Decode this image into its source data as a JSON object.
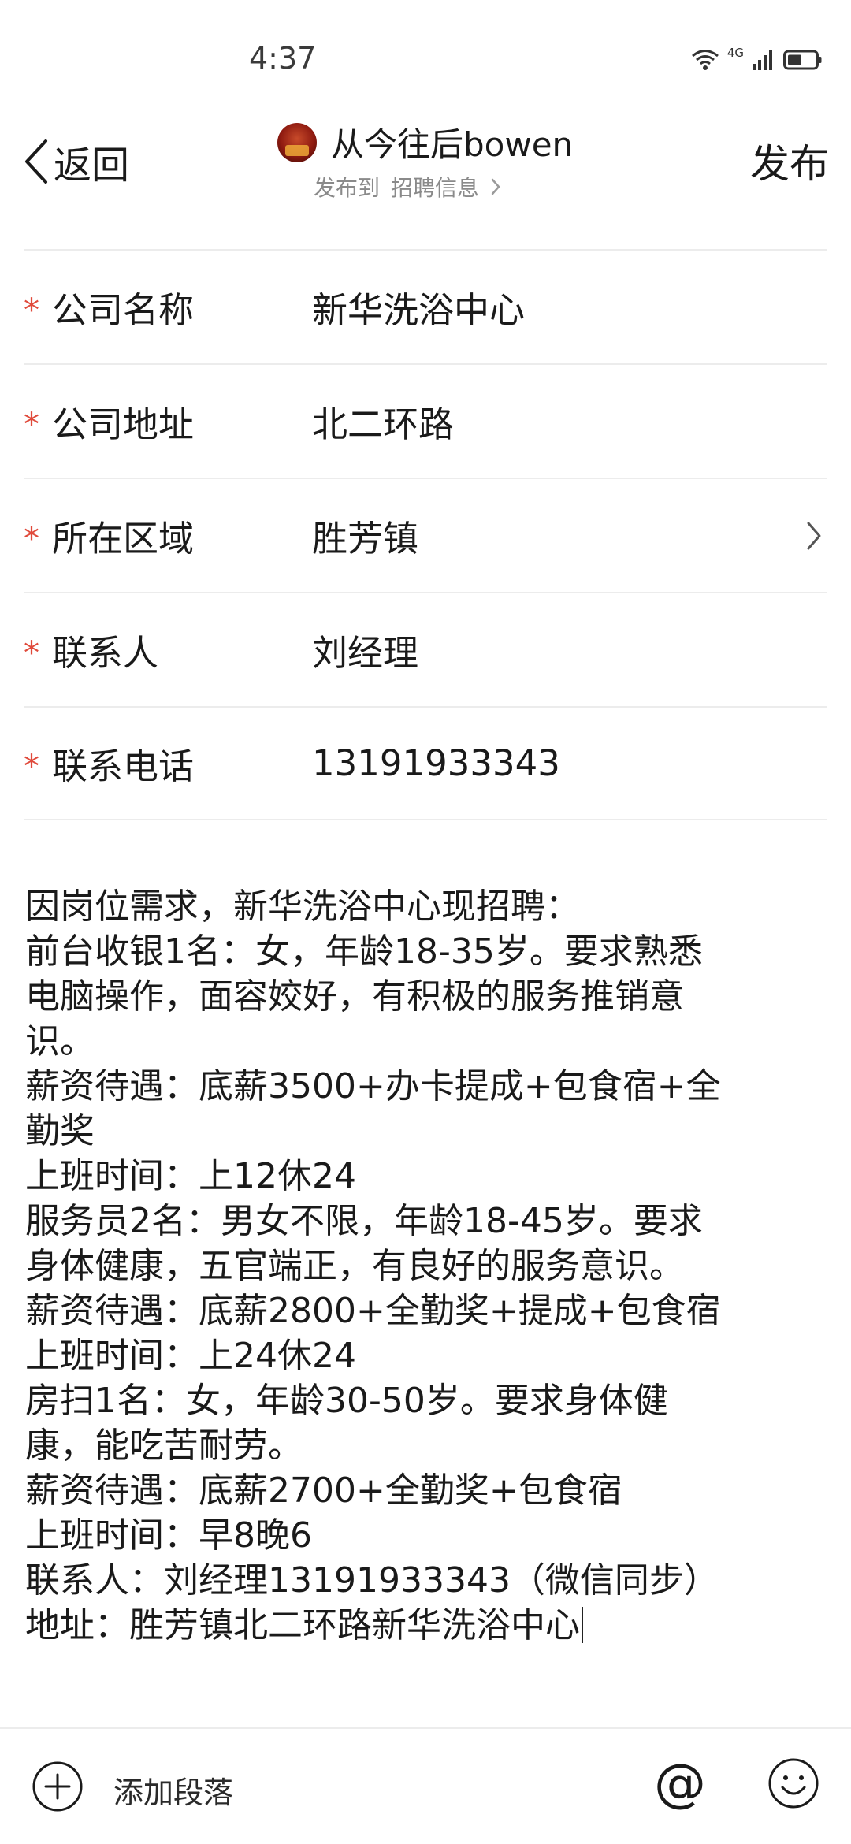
{
  "status_bar": {
    "time": "4:37",
    "network": "4G"
  },
  "header": {
    "back_label": "返回",
    "account_name": "从今往后bowen",
    "publish_to_prefix": "发布到",
    "publish_to_target": "招聘信息",
    "publish_label": "发布"
  },
  "form": {
    "rows": [
      {
        "label": "公司名称",
        "value": "新华洗浴中心"
      },
      {
        "label": "公司地址",
        "value": "北二环路"
      },
      {
        "label": "所在区域",
        "value": "胜芳镇"
      },
      {
        "label": "联系人",
        "value": "刘经理"
      },
      {
        "label": "联系电话",
        "value": "13191933343"
      }
    ],
    "required_mark": "*"
  },
  "content": {
    "lines": [
      "因岗位需求，新华洗浴中心现招聘：",
      "前台收银1名：女，年龄18-35岁。要求熟悉",
      "电脑操作，面容姣好，有积极的服务推销意",
      "识。",
      "薪资待遇：底薪3500+办卡提成+包食宿+全",
      "勤奖",
      "上班时间：上12休24",
      "服务员2名：男女不限，年龄18-45岁。要求",
      "身体健康，五官端正，有良好的服务意识。",
      "薪资待遇：底薪2800+全勤奖+提成+包食宿",
      "上班时间：上24休24",
      "房扫1名：女，年龄30-50岁。要求身体健",
      "康，能吃苦耐劳。",
      "薪资待遇：底薪2700+全勤奖+包食宿",
      "上班时间：早8晚6",
      "联系人：刘经理13191933343（微信同步）",
      "地址：胜芳镇北二环路新华洗浴中心"
    ]
  },
  "bottom_bar": {
    "add_paragraph_label": "添加段落",
    "mention_symbol": "@"
  },
  "colors": {
    "required": "#e04a3b",
    "divider": "#ececec",
    "subtitle": "#8a8a8a"
  }
}
